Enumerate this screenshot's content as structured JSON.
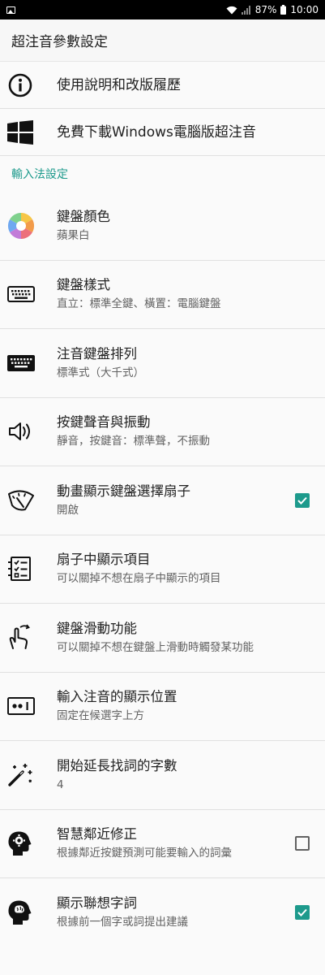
{
  "status_bar": {
    "battery": "87%",
    "time": "10:00"
  },
  "app_bar": {
    "title": "超注音參數設定"
  },
  "top_items": [
    {
      "title": "使用說明和改版履歷",
      "icon": "info-icon"
    },
    {
      "title": "免費下載Windows電腦版超注音",
      "icon": "windows-icon"
    }
  ],
  "section": {
    "title": "輸入法設定"
  },
  "prefs": [
    {
      "title": "鍵盤顏色",
      "summary": "蘋果白",
      "icon": "color-wheel-icon"
    },
    {
      "title": "鍵盤樣式",
      "summary": "直立：標準全鍵、橫置：電腦鍵盤",
      "icon": "keyboard-icon"
    },
    {
      "title": "注音鍵盤排列",
      "summary": "標準式（大千式）",
      "icon": "keyboard-filled-icon"
    },
    {
      "title": "按鍵聲音與振動",
      "summary": "靜音，按鍵音：標準聲，不振動",
      "icon": "speaker-icon"
    },
    {
      "title": "動畫顯示鍵盤選擇扇子",
      "summary": "開啟",
      "icon": "fan-gauge-icon",
      "checked": true
    },
    {
      "title": "扇子中顯示項目",
      "summary": "可以關掉不想在扇子中顯示的項目",
      "icon": "checklist-icon"
    },
    {
      "title": "鍵盤滑動功能",
      "summary": "可以關掉不想在鍵盤上滑動時觸發某功能",
      "icon": "swipe-gesture-icon"
    },
    {
      "title": "輸入注音的顯示位置",
      "summary": "固定在候選字上方",
      "icon": "display-position-icon"
    },
    {
      "title": "開始延長找詞的字數",
      "summary": "4",
      "icon": "magic-wand-icon"
    },
    {
      "title": "智慧鄰近修正",
      "summary": "根據鄰近按鍵預測可能要輸入的詞彙",
      "icon": "head-gear-icon",
      "checked": false
    },
    {
      "title": "顯示聯想字詞",
      "summary": "根據前一個字或詞提出建議",
      "icon": "head-brain-icon",
      "checked": true
    }
  ],
  "colors": {
    "accent": "#1d9a8c",
    "divider": "#e0e0e0",
    "summary_text": "#616161"
  }
}
